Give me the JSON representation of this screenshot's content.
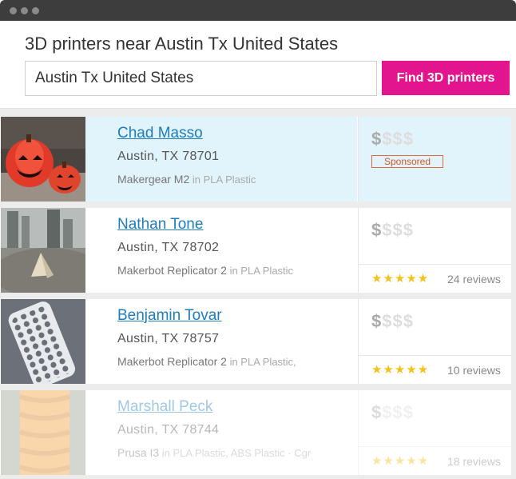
{
  "header": {
    "title": "3D printers near Austin Tx United States",
    "search_value": "Austin Tx United States",
    "button_label": "Find 3D printers"
  },
  "results": [
    {
      "name": "Chad Masso",
      "location": "Austin, TX 78701",
      "printer": "Makergear M2",
      "materials": " in PLA Plastic",
      "price_symbols": "$$$$",
      "price_level": 1,
      "badge": "Sponsored",
      "image": "jack-o-lantern-photo"
    },
    {
      "name": "Nathan Tone",
      "location": "Austin, TX 78702",
      "printer": "Makerbot Replicator 2",
      "materials": " in PLA Plastic",
      "price_symbols": "$$$$",
      "price_level": 1,
      "rating": 5,
      "stars": "★★★★★",
      "reviews": "24 reviews",
      "image": "pyramid-print-photo"
    },
    {
      "name": "Benjamin Tovar",
      "location": "Austin, TX 78757",
      "printer": "Makerbot Replicator 2",
      "materials": " in PLA Plastic,",
      "price_symbols": "$$$$",
      "price_level": 1,
      "rating": 5,
      "stars": "★★★★★",
      "reviews": "10 reviews",
      "image": "phone-case-photo"
    },
    {
      "name": "Marshall Peck",
      "location": "Austin, TX 78744",
      "printer": "Prusa I3",
      "materials": " in PLA Plastic, ABS Plastic",
      "extra": " · Cgr",
      "price_symbols": "$$$$",
      "price_level": 1,
      "rating": 5,
      "stars": "★★★★★",
      "reviews": "18 reviews",
      "image": "orange-twist-vase-photo"
    }
  ],
  "colors": {
    "accent": "#e3158e",
    "link": "#1f7dbd",
    "sponsored_bg": "#e1f3fb",
    "star": "#f2c31a",
    "titlebar": "#3d3d3d"
  }
}
